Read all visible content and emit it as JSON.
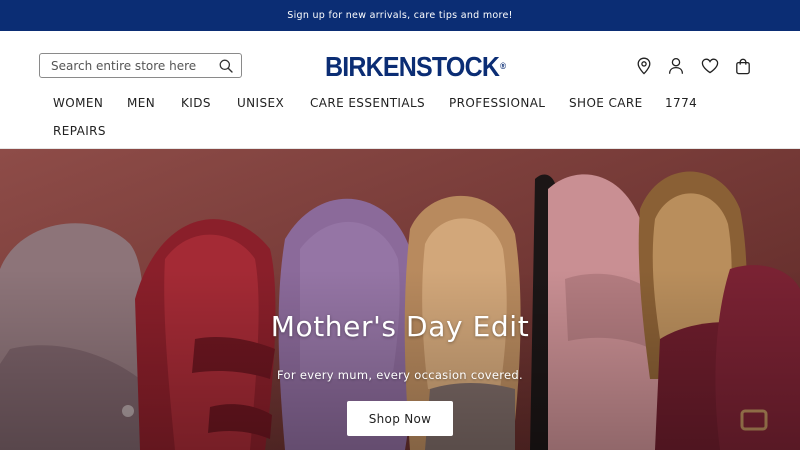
{
  "promo_bar": {
    "text": "Sign up for new arrivals, care tips and more!"
  },
  "header": {
    "search": {
      "placeholder": "Search entire store here",
      "value": ""
    },
    "logo": {
      "text": "BIRKENSTOCK",
      "registered": "®"
    },
    "icons": [
      "location-pin-icon",
      "account-icon",
      "wishlist-heart-icon",
      "shopping-bag-icon"
    ]
  },
  "nav": {
    "items": [
      {
        "label": "WOMEN"
      },
      {
        "label": "MEN"
      },
      {
        "label": "KIDS"
      },
      {
        "label": "UNISEX"
      },
      {
        "label": "CARE ESSENTIALS"
      },
      {
        "label": "PROFESSIONAL"
      },
      {
        "label": "SHOE CARE"
      },
      {
        "label": "1774"
      },
      {
        "label": "REPAIRS"
      }
    ]
  },
  "hero": {
    "title": "Mother's Day Edit",
    "subtitle": "For every mum, every occasion covered.",
    "cta_label": "Shop Now"
  },
  "colors": {
    "brand_navy": "#0b2d74",
    "hero_background": "#7a3b39",
    "text_dark": "#222222"
  }
}
